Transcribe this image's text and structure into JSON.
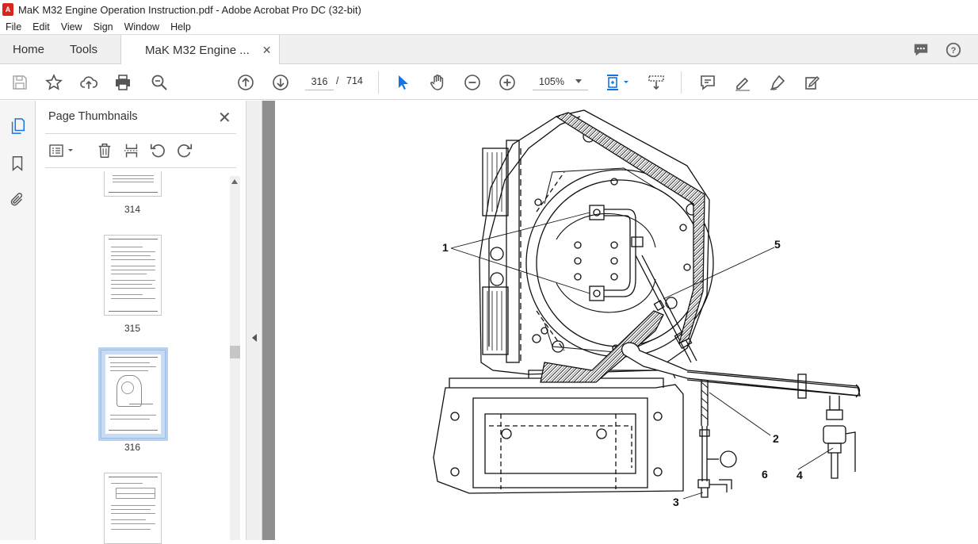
{
  "window": {
    "title": "MaK M32 Engine Operation Instruction.pdf - Adobe Acrobat Pro DC (32-bit)"
  },
  "menu": [
    "File",
    "Edit",
    "View",
    "Sign",
    "Window",
    "Help"
  ],
  "tabs": {
    "home": "Home",
    "tools": "Tools",
    "document": "MaK M32 Engine ..."
  },
  "navigation": {
    "current_page": "316",
    "separator": "/",
    "total_pages": "714",
    "zoom": "105%"
  },
  "panel": {
    "title": "Page Thumbnails",
    "thumbnails": [
      {
        "label": "314"
      },
      {
        "label": "315"
      },
      {
        "label": "316",
        "selected": true
      },
      {
        "label": ""
      }
    ]
  },
  "figure": {
    "callouts": [
      "1",
      "5",
      "2",
      "6",
      "4",
      "3"
    ]
  },
  "colors": {
    "accent": "#1473e6",
    "selection": "#b6d2f1"
  }
}
